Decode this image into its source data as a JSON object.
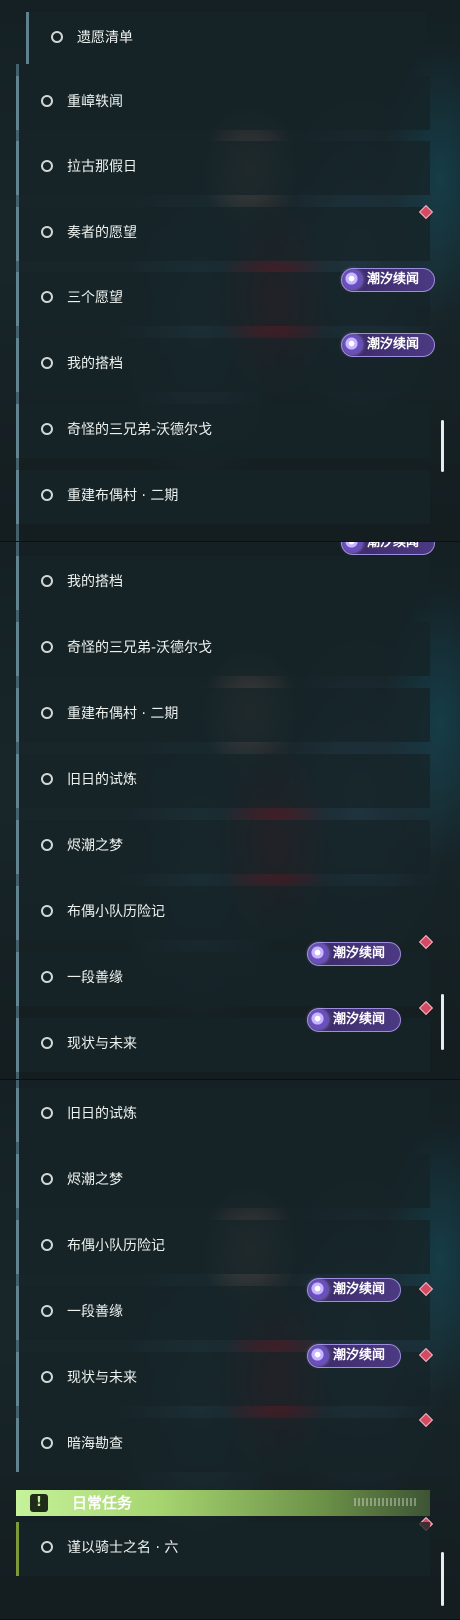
{
  "badge_label": "潮汐续闻",
  "panels": [
    {
      "items": [
        "遗愿清单",
        "重嶂轶闻",
        "拉古那假日",
        "奏者的愿望",
        "三个愿望",
        "我的搭档",
        "奇怪的三兄弟-沃德尔戈",
        "重建布偶村 · 二期"
      ]
    },
    {
      "items": [
        "我的搭档",
        "奇怪的三兄弟-沃德尔戈",
        "重建布偶村 · 二期",
        "旧日的试炼",
        "烬潮之梦",
        "布偶小队历险记",
        "一段善缘",
        "现状与未来"
      ]
    },
    {
      "items": [
        "旧日的试炼",
        "烬潮之梦",
        "布偶小队历险记",
        "一段善缘",
        "现状与未来",
        "暗海勘查"
      ],
      "section": {
        "icon": "!",
        "title": "日常任务"
      },
      "quest_item": "谨以骑士之名 · 六"
    }
  ],
  "colors": {
    "tide_badge": "#4b3a82",
    "new_marker": "#d34b62",
    "section_header": "#a6d46f"
  },
  "icons": {
    "item": "circle-outline-icon",
    "badge": "tide-swirl-icon",
    "marker": "diamond-icon",
    "section": "exclamation-icon"
  }
}
